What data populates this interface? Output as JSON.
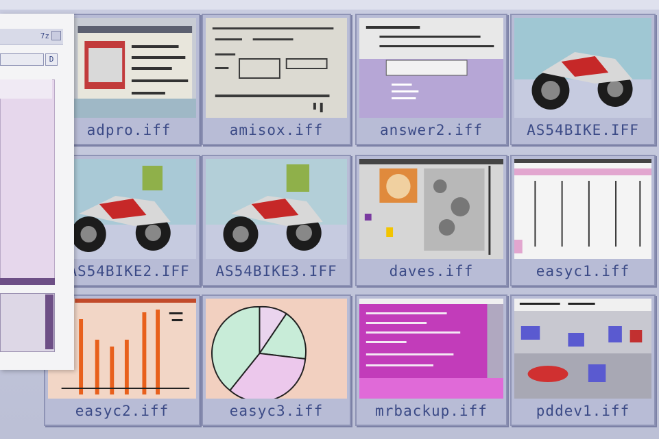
{
  "files": [
    {
      "name": "adpro.iff"
    },
    {
      "name": "amisox.iff"
    },
    {
      "name": "answer2.iff"
    },
    {
      "name": "AS54BIKE.IFF"
    },
    {
      "name": "AS54BIKE2.IFF"
    },
    {
      "name": "AS54BIKE3.IFF"
    },
    {
      "name": "daves.iff"
    },
    {
      "name": "easyc1.iff"
    },
    {
      "name": "easyc2.iff"
    },
    {
      "name": "easyc3.iff"
    },
    {
      "name": "mrbackup.iff"
    },
    {
      "name": "pddev1.iff"
    }
  ],
  "side_panel": {
    "title_text": "7z",
    "field_button": "D"
  },
  "colors": {
    "label_text": "#3b4a86",
    "tile_bg": "#b8bcd6",
    "accent_purple": "#6d4f86"
  },
  "icons": [
    "depth-gadget-icon"
  ]
}
